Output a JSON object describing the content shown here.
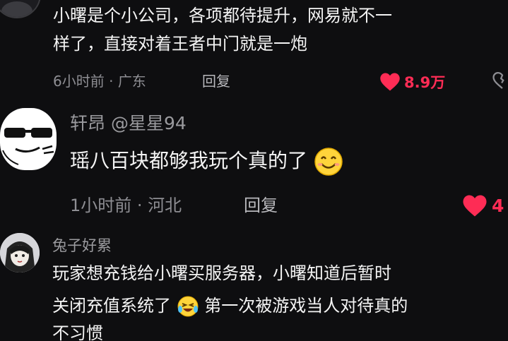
{
  "comments": [
    {
      "username": "",
      "text_lines": [
        "小曙是个小公司，各项都待提升，网易就不一",
        "样了，直接对着王者中门就是一炮"
      ],
      "time": "6小时前",
      "location": "广东",
      "reply_label": "回复",
      "likes": "8.9万",
      "avatar_icon": "dark-avatar-icon"
    },
    {
      "username": "轩昂 @星星94",
      "text_lines": [
        "瑶八百块都够我玩个真的了"
      ],
      "time": "1小时前",
      "location": "河北",
      "reply_label": "回复",
      "likes": "4",
      "avatar_icon": "sunglasses-cartoon-avatar-icon",
      "emoji": "smiling-face-emoji"
    },
    {
      "username": "兔子好累",
      "text_lines": [
        "玩家想充钱给小曙买服务器，小曙知道后暂时",
        "关闭充值系统了",
        "第一次被游戏当人对待真的",
        "不习惯"
      ],
      "avatar_icon": "anime-character-avatar-icon",
      "emoji": "laughing-tears-emoji"
    }
  ],
  "colors": {
    "background": "#0e0e10",
    "like_red": "#fe2c55",
    "meta_gray": "#8e8e93",
    "text_white": "#f4f4f4"
  }
}
